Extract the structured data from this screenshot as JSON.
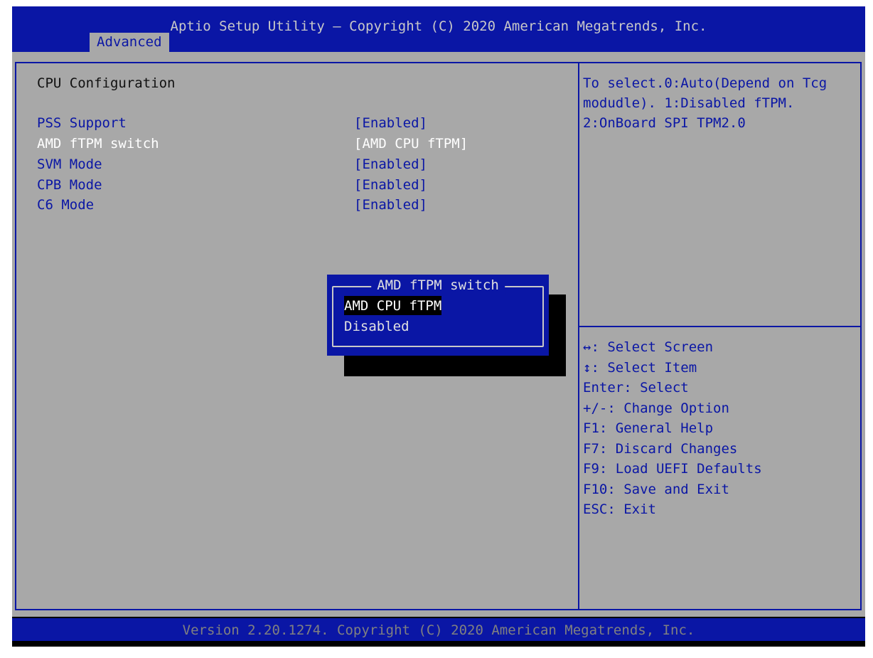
{
  "header": {
    "title": "Aptio Setup Utility – Copyright (C) 2020 American Megatrends, Inc.",
    "tab": "Advanced"
  },
  "main": {
    "section_title": "CPU Configuration",
    "settings": [
      {
        "label": "PSS Support",
        "value": "[Enabled]"
      },
      {
        "label": "AMD fTPM switch",
        "value": "[AMD CPU fTPM]",
        "selected": true
      },
      {
        "label": "SVM Mode",
        "value": "[Enabled]"
      },
      {
        "label": "CPB Mode",
        "value": "[Enabled]"
      },
      {
        "label": "C6 Mode",
        "value": "[Enabled]"
      }
    ]
  },
  "help": {
    "text": "To select.0:Auto(Depend on Tcg\nmodudle). 1:Disabled fTPM.\n2:OnBoard SPI TPM2.0"
  },
  "keys": [
    "↔: Select Screen",
    "↕: Select Item",
    "Enter: Select",
    "+/-: Change Option",
    "F1: General Help",
    "F7: Discard Changes",
    "F9: Load UEFI Defaults",
    "F10: Save and Exit",
    "ESC: Exit"
  ],
  "popup": {
    "title": "AMD fTPM switch",
    "options": [
      "AMD CPU fTPM",
      "Disabled"
    ],
    "highlighted_index": 0
  },
  "footer": {
    "text": "Version 2.20.1274. Copyright (C) 2020 American Megatrends, Inc."
  },
  "colors": {
    "bios_blue": "#0a16a5",
    "bios_gray": "#a8a8a8",
    "selected_text": "#ffffff"
  }
}
